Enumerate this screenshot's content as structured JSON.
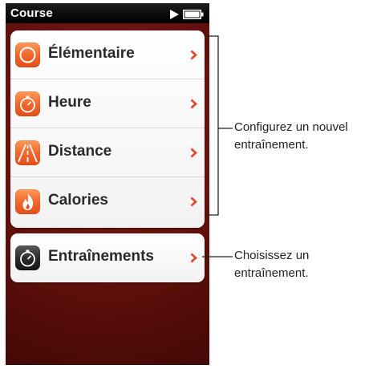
{
  "app": {
    "title": "Course",
    "status_icons": [
      "play-icon",
      "battery-icon"
    ]
  },
  "menu": {
    "items": [
      {
        "label": "Élémentaire",
        "icon": "basic-circle-icon"
      },
      {
        "label": "Heure",
        "icon": "stopwatch-icon"
      },
      {
        "label": "Distance",
        "icon": "road-icon"
      },
      {
        "label": "Calories",
        "icon": "flame-icon"
      }
    ],
    "secondary": {
      "label": "Entraînements",
      "icon": "workouts-stopwatch-icon"
    }
  },
  "annotations": {
    "new_workout": "Configurez un nouvel\nentraînement.",
    "choose_workout": "Choisissez un\nentraînement."
  },
  "colors": {
    "accent": "#e8452a",
    "background": "#6b1410"
  }
}
